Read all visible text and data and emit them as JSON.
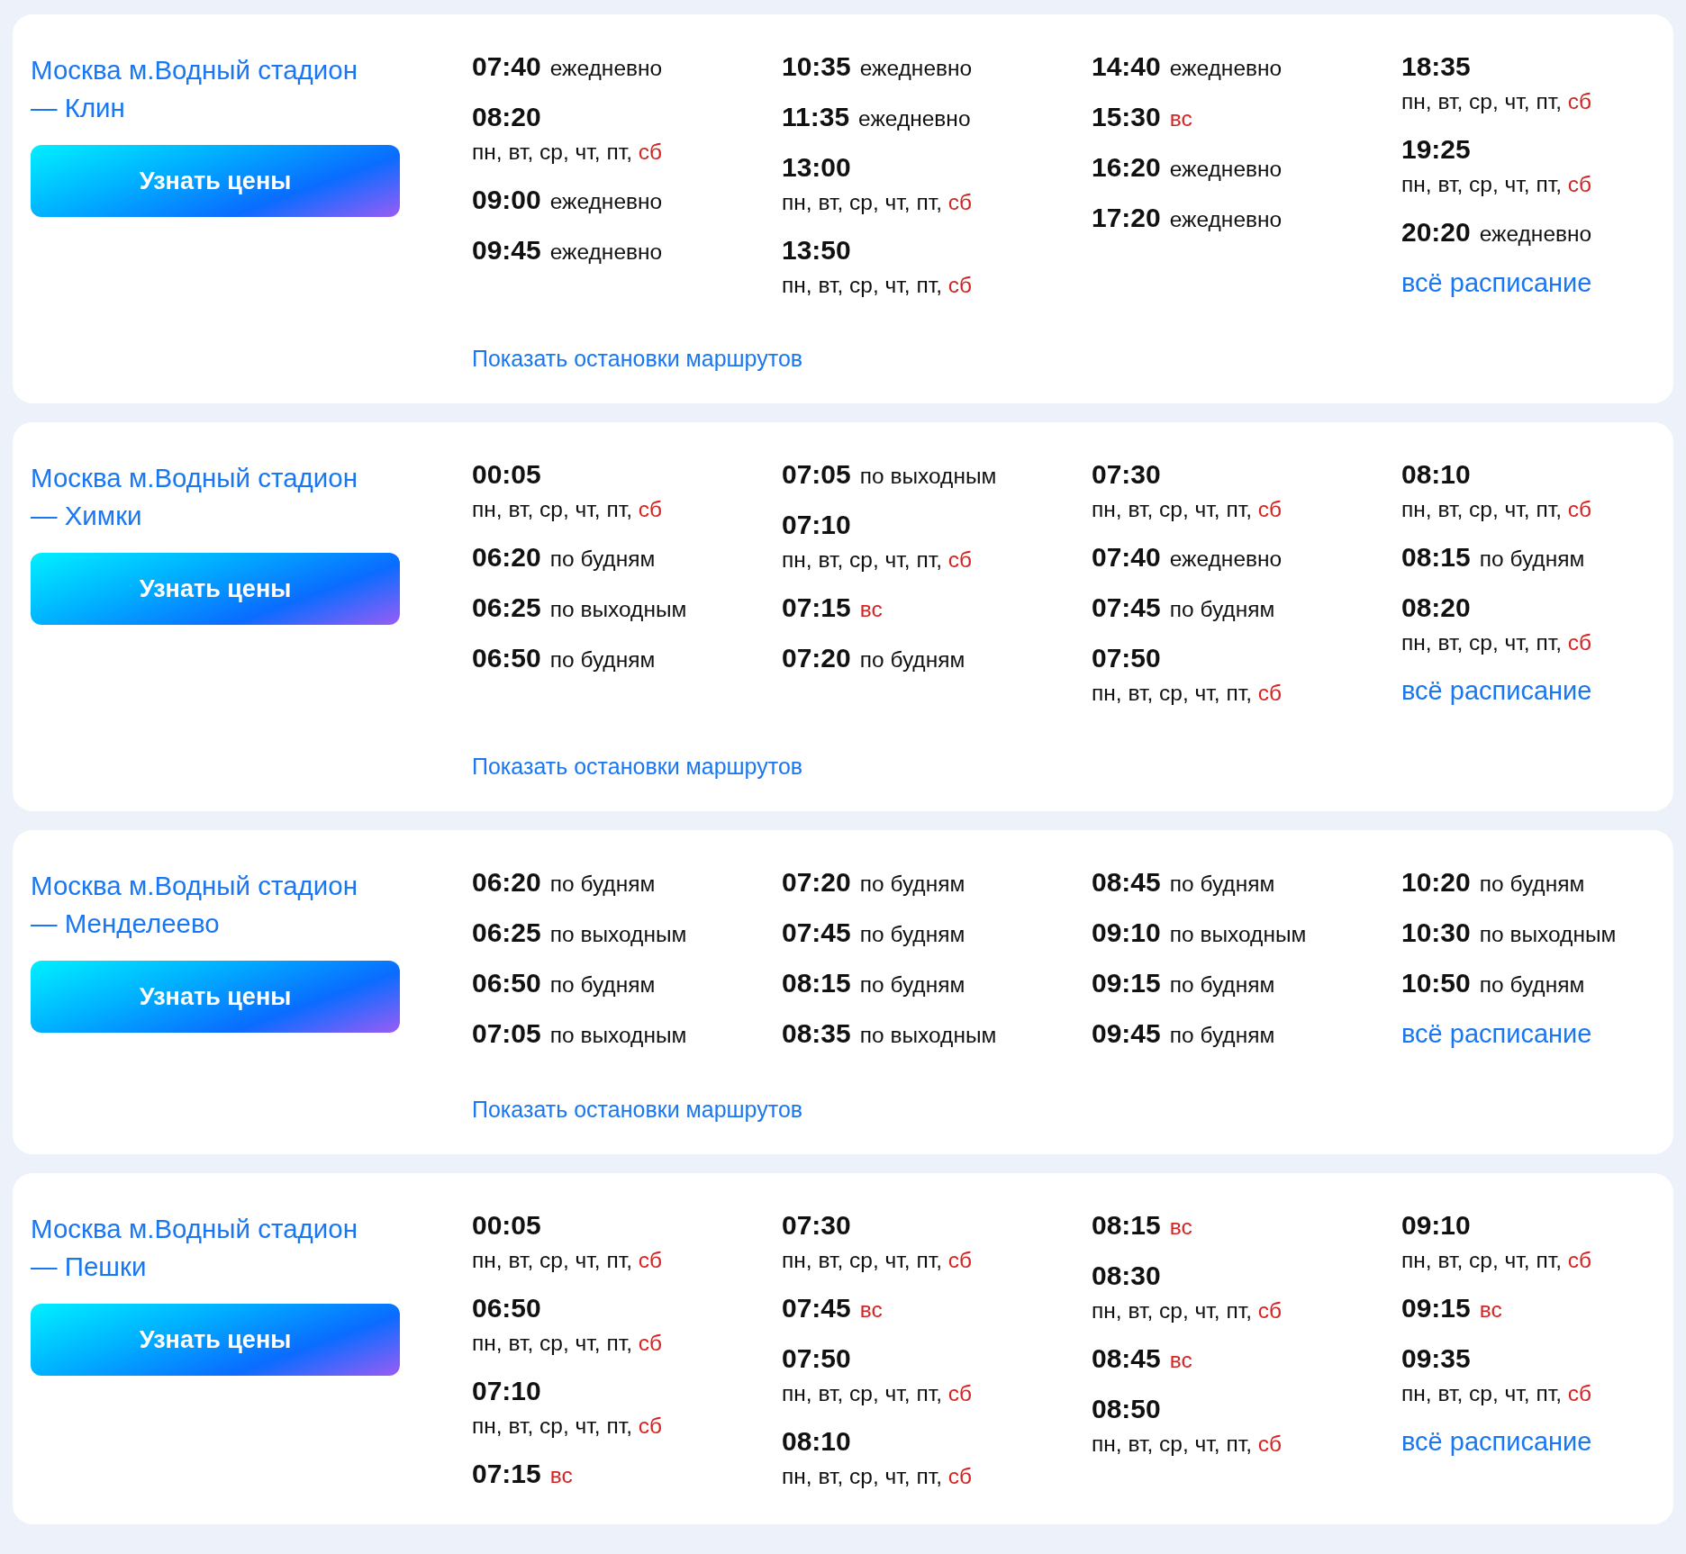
{
  "routes": [
    {
      "title": "Москва м.Водный стадион — Клин",
      "button": "Узнать цены",
      "all_link": "всё расписание",
      "stops_link": "Показать остановки маршрутов",
      "columns": [
        [
          {
            "time": "07:40",
            "kind": "inline",
            "note": [
              {
                "text": "ежедневно",
                "weekend": false
              }
            ]
          },
          {
            "time": "08:20",
            "kind": "stacked",
            "note": [
              {
                "text": "пн, вт, ср, чт, пт, ",
                "weekend": false
              },
              {
                "text": "сб",
                "weekend": true
              }
            ]
          },
          {
            "time": "09:00",
            "kind": "inline",
            "note": [
              {
                "text": "ежедневно",
                "weekend": false
              }
            ]
          },
          {
            "time": "09:45",
            "kind": "inline",
            "note": [
              {
                "text": "ежедневно",
                "weekend": false
              }
            ]
          }
        ],
        [
          {
            "time": "10:35",
            "kind": "inline",
            "note": [
              {
                "text": "ежедневно",
                "weekend": false
              }
            ]
          },
          {
            "time": "11:35",
            "kind": "inline",
            "note": [
              {
                "text": "ежедневно",
                "weekend": false
              }
            ]
          },
          {
            "time": "13:00",
            "kind": "stacked",
            "note": [
              {
                "text": "пн, вт, ср, чт, пт, ",
                "weekend": false
              },
              {
                "text": "сб",
                "weekend": true
              }
            ]
          },
          {
            "time": "13:50",
            "kind": "stacked",
            "note": [
              {
                "text": "пн, вт, ср, чт, пт, ",
                "weekend": false
              },
              {
                "text": "сб",
                "weekend": true
              }
            ]
          }
        ],
        [
          {
            "time": "14:40",
            "kind": "inline",
            "note": [
              {
                "text": "ежедневно",
                "weekend": false
              }
            ]
          },
          {
            "time": "15:30",
            "kind": "inline",
            "note": [
              {
                "text": "вс",
                "weekend": true
              }
            ]
          },
          {
            "time": "16:20",
            "kind": "inline",
            "note": [
              {
                "text": "ежедневно",
                "weekend": false
              }
            ]
          },
          {
            "time": "17:20",
            "kind": "inline",
            "note": [
              {
                "text": "ежедневно",
                "weekend": false
              }
            ]
          }
        ],
        [
          {
            "time": "18:35",
            "kind": "stacked",
            "note": [
              {
                "text": "пн, вт, ср, чт, пт, ",
                "weekend": false
              },
              {
                "text": "сб",
                "weekend": true
              }
            ]
          },
          {
            "time": "19:25",
            "kind": "stacked",
            "note": [
              {
                "text": "пн, вт, ср, чт, пт, ",
                "weekend": false
              },
              {
                "text": "сб",
                "weekend": true
              }
            ]
          },
          {
            "time": "20:20",
            "kind": "inline",
            "note": [
              {
                "text": "ежедневно",
                "weekend": false
              }
            ]
          }
        ]
      ]
    },
    {
      "title": "Москва м.Водный стадион — Химки",
      "button": "Узнать цены",
      "all_link": "всё расписание",
      "stops_link": "Показать остановки маршрутов",
      "columns": [
        [
          {
            "time": "00:05",
            "kind": "stacked",
            "note": [
              {
                "text": "пн, вт, ср, чт, пт, ",
                "weekend": false
              },
              {
                "text": "сб",
                "weekend": true
              }
            ]
          },
          {
            "time": "06:20",
            "kind": "inline",
            "note": [
              {
                "text": "по будням",
                "weekend": false
              }
            ]
          },
          {
            "time": "06:25",
            "kind": "inline",
            "note": [
              {
                "text": "по выходным",
                "weekend": false
              }
            ]
          },
          {
            "time": "06:50",
            "kind": "inline",
            "note": [
              {
                "text": "по будням",
                "weekend": false
              }
            ]
          }
        ],
        [
          {
            "time": "07:05",
            "kind": "inline",
            "note": [
              {
                "text": "по выходным",
                "weekend": false
              }
            ]
          },
          {
            "time": "07:10",
            "kind": "stacked",
            "note": [
              {
                "text": "пн, вт, ср, чт, пт, ",
                "weekend": false
              },
              {
                "text": "сб",
                "weekend": true
              }
            ]
          },
          {
            "time": "07:15",
            "kind": "inline",
            "note": [
              {
                "text": "вс",
                "weekend": true
              }
            ]
          },
          {
            "time": "07:20",
            "kind": "inline",
            "note": [
              {
                "text": "по будням",
                "weekend": false
              }
            ]
          }
        ],
        [
          {
            "time": "07:30",
            "kind": "stacked",
            "note": [
              {
                "text": "пн, вт, ср, чт, пт, ",
                "weekend": false
              },
              {
                "text": "сб",
                "weekend": true
              }
            ]
          },
          {
            "time": "07:40",
            "kind": "inline",
            "note": [
              {
                "text": "ежедневно",
                "weekend": false
              }
            ]
          },
          {
            "time": "07:45",
            "kind": "inline",
            "note": [
              {
                "text": "по будням",
                "weekend": false
              }
            ]
          },
          {
            "time": "07:50",
            "kind": "stacked",
            "note": [
              {
                "text": "пн, вт, ср, чт, пт, ",
                "weekend": false
              },
              {
                "text": "сб",
                "weekend": true
              }
            ]
          }
        ],
        [
          {
            "time": "08:10",
            "kind": "stacked",
            "note": [
              {
                "text": "пн, вт, ср, чт, пт, ",
                "weekend": false
              },
              {
                "text": "сб",
                "weekend": true
              }
            ]
          },
          {
            "time": "08:15",
            "kind": "inline",
            "note": [
              {
                "text": "по будням",
                "weekend": false
              }
            ]
          },
          {
            "time": "08:20",
            "kind": "stacked",
            "note": [
              {
                "text": "пн, вт, ср, чт, пт, ",
                "weekend": false
              },
              {
                "text": "сб",
                "weekend": true
              }
            ]
          }
        ]
      ]
    },
    {
      "title": "Москва м.Водный стадион — Менделеево",
      "button": "Узнать цены",
      "all_link": "всё расписание",
      "stops_link": "Показать остановки маршрутов",
      "columns": [
        [
          {
            "time": "06:20",
            "kind": "inline",
            "note": [
              {
                "text": "по будням",
                "weekend": false
              }
            ]
          },
          {
            "time": "06:25",
            "kind": "inline",
            "note": [
              {
                "text": "по выходным",
                "weekend": false
              }
            ]
          },
          {
            "time": "06:50",
            "kind": "inline",
            "note": [
              {
                "text": "по будням",
                "weekend": false
              }
            ]
          },
          {
            "time": "07:05",
            "kind": "inline",
            "note": [
              {
                "text": "по выходным",
                "weekend": false
              }
            ]
          }
        ],
        [
          {
            "time": "07:20",
            "kind": "inline",
            "note": [
              {
                "text": "по будням",
                "weekend": false
              }
            ]
          },
          {
            "time": "07:45",
            "kind": "inline",
            "note": [
              {
                "text": "по будням",
                "weekend": false
              }
            ]
          },
          {
            "time": "08:15",
            "kind": "inline",
            "note": [
              {
                "text": "по будням",
                "weekend": false
              }
            ]
          },
          {
            "time": "08:35",
            "kind": "inline",
            "note": [
              {
                "text": "по выходным",
                "weekend": false
              }
            ]
          }
        ],
        [
          {
            "time": "08:45",
            "kind": "inline",
            "note": [
              {
                "text": "по будням",
                "weekend": false
              }
            ]
          },
          {
            "time": "09:10",
            "kind": "inline",
            "note": [
              {
                "text": "по выходным",
                "weekend": false
              }
            ]
          },
          {
            "time": "09:15",
            "kind": "inline",
            "note": [
              {
                "text": "по будням",
                "weekend": false
              }
            ]
          },
          {
            "time": "09:45",
            "kind": "inline",
            "note": [
              {
                "text": "по будням",
                "weekend": false
              }
            ]
          }
        ],
        [
          {
            "time": "10:20",
            "kind": "inline",
            "note": [
              {
                "text": "по будням",
                "weekend": false
              }
            ]
          },
          {
            "time": "10:30",
            "kind": "inline",
            "note": [
              {
                "text": "по выходным",
                "weekend": false
              }
            ]
          },
          {
            "time": "10:50",
            "kind": "inline",
            "note": [
              {
                "text": "по будням",
                "weekend": false
              }
            ]
          }
        ]
      ]
    },
    {
      "title": "Москва м.Водный стадион — Пешки",
      "button": "Узнать цены",
      "all_link": "всё расписание",
      "columns": [
        [
          {
            "time": "00:05",
            "kind": "stacked",
            "note": [
              {
                "text": "пн, вт, ср, чт, пт, ",
                "weekend": false
              },
              {
                "text": "сб",
                "weekend": true
              }
            ]
          },
          {
            "time": "06:50",
            "kind": "stacked",
            "note": [
              {
                "text": "пн, вт, ср, чт, пт, ",
                "weekend": false
              },
              {
                "text": "сб",
                "weekend": true
              }
            ]
          },
          {
            "time": "07:10",
            "kind": "stacked",
            "note": [
              {
                "text": "пн, вт, ср, чт, пт, ",
                "weekend": false
              },
              {
                "text": "сб",
                "weekend": true
              }
            ]
          },
          {
            "time": "07:15",
            "kind": "inline",
            "note": [
              {
                "text": "вс",
                "weekend": true
              }
            ]
          }
        ],
        [
          {
            "time": "07:30",
            "kind": "stacked",
            "note": [
              {
                "text": "пн, вт, ср, чт, пт, ",
                "weekend": false
              },
              {
                "text": "сб",
                "weekend": true
              }
            ]
          },
          {
            "time": "07:45",
            "kind": "inline",
            "note": [
              {
                "text": "вс",
                "weekend": true
              }
            ]
          },
          {
            "time": "07:50",
            "kind": "stacked",
            "note": [
              {
                "text": "пн, вт, ср, чт, пт, ",
                "weekend": false
              },
              {
                "text": "сб",
                "weekend": true
              }
            ]
          },
          {
            "time": "08:10",
            "kind": "stacked",
            "note": [
              {
                "text": "пн, вт, ср, чт, пт, ",
                "weekend": false
              },
              {
                "text": "сб",
                "weekend": true
              }
            ]
          }
        ],
        [
          {
            "time": "08:15",
            "kind": "inline",
            "note": [
              {
                "text": "вс",
                "weekend": true
              }
            ]
          },
          {
            "time": "08:30",
            "kind": "stacked",
            "note": [
              {
                "text": "пн, вт, ср, чт, пт, ",
                "weekend": false
              },
              {
                "text": "сб",
                "weekend": true
              }
            ]
          },
          {
            "time": "08:45",
            "kind": "inline",
            "note": [
              {
                "text": "вс",
                "weekend": true
              }
            ]
          },
          {
            "time": "08:50",
            "kind": "stacked",
            "note": [
              {
                "text": "пн, вт, ср, чт, пт, ",
                "weekend": false
              },
              {
                "text": "сб",
                "weekend": true
              }
            ]
          }
        ],
        [
          {
            "time": "09:10",
            "kind": "stacked",
            "note": [
              {
                "text": "пн, вт, ср, чт, пт, ",
                "weekend": false
              },
              {
                "text": "сб",
                "weekend": true
              }
            ]
          },
          {
            "time": "09:15",
            "kind": "inline",
            "note": [
              {
                "text": "вс",
                "weekend": true
              }
            ]
          },
          {
            "time": "09:35",
            "kind": "stacked",
            "note": [
              {
                "text": "пн, вт, ср, чт, пт, ",
                "weekend": false
              },
              {
                "text": "сб",
                "weekend": true
              }
            ]
          }
        ]
      ]
    }
  ]
}
